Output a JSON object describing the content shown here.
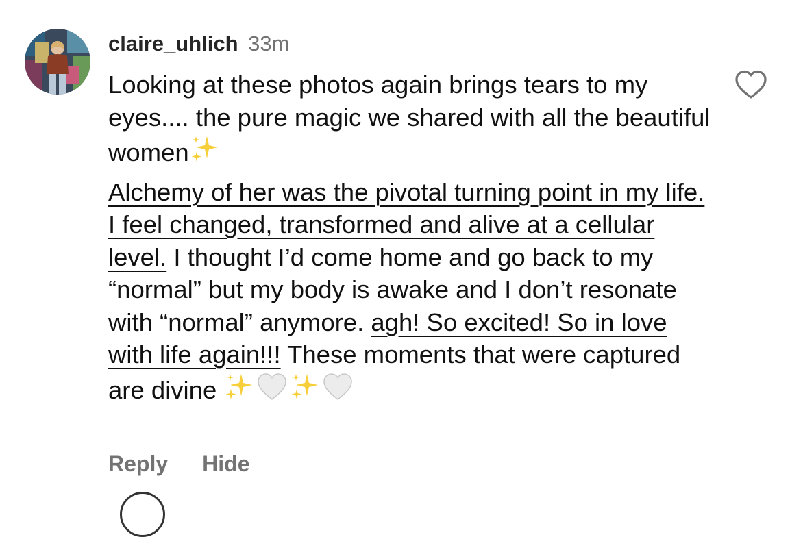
{
  "comment": {
    "username": "claire_uhlich",
    "time": "33m",
    "paragraph1": "Looking at these photos again brings tears to my eyes.... the pure magic we shared with all the beautiful women",
    "paragraph2": {
      "underlined_1": "Alchemy of her was the pivotal turning point in my life. I feel changed, transformed and alive at a cellular level.",
      "text_1": " I thought I’d come home and go back to my “normal” but my body is awake and I don’t resonate with “normal” anymore. ",
      "underlined_2": "agh! So excited! So in love with life again!!!",
      "text_2": " These moments that were captured are divine "
    },
    "emojis": {
      "paragraph1_end": "sparkles-icon",
      "paragraph2_end": [
        "sparkles-icon",
        "white-heart-icon",
        "sparkles-icon",
        "white-heart-icon"
      ]
    }
  },
  "actions": {
    "reply_label": "Reply",
    "hide_label": "Hide"
  },
  "colors": {
    "text": "#111111",
    "secondary": "#737373",
    "sparkle": "#f7cf3a",
    "white_heart_fill": "#ececec",
    "white_heart_stroke": "#c8c8c8"
  }
}
